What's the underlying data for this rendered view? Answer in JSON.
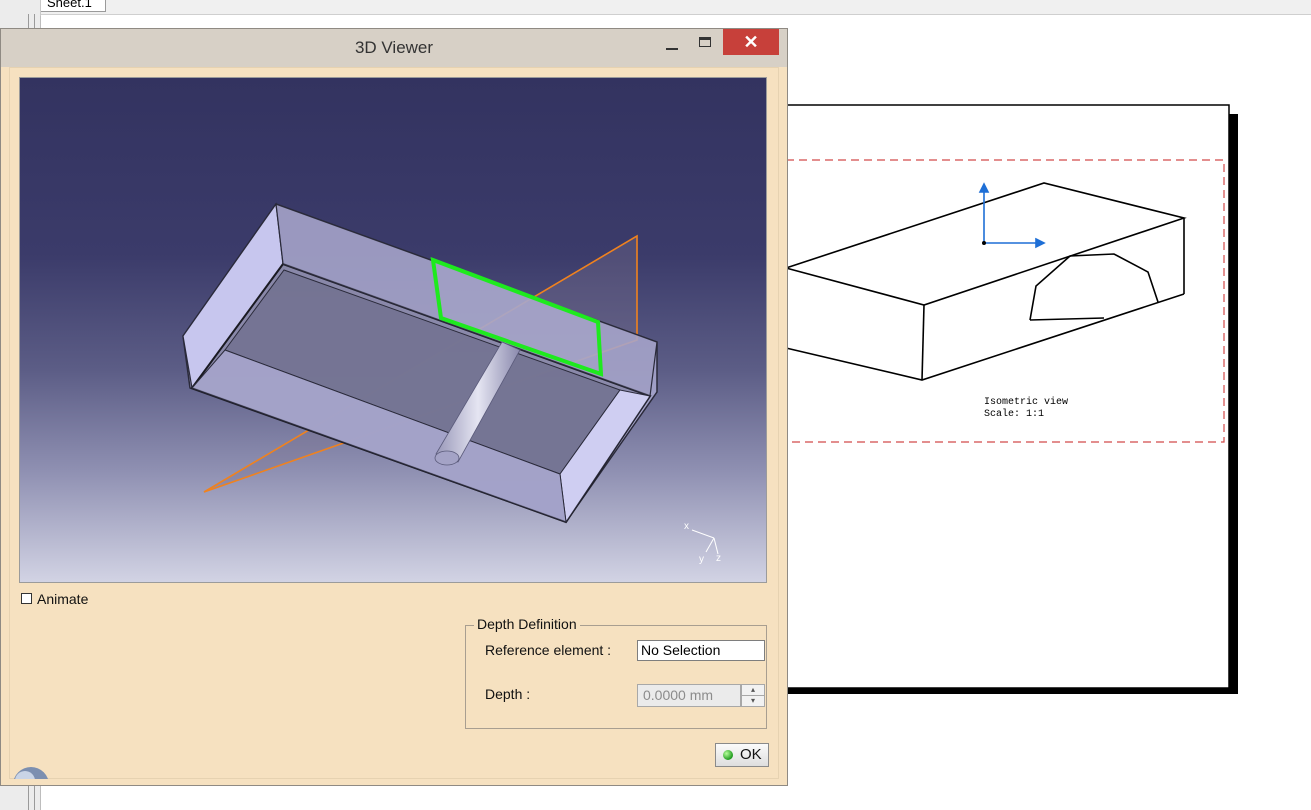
{
  "background": {
    "sheet_tab": "Sheet.1",
    "view_label": "Isometric view",
    "scale_label": "Scale:  1:1"
  },
  "dialog": {
    "title": "3D Viewer",
    "minimize_icon": "minimize-icon",
    "maximize_icon": "maximize-icon",
    "close_icon": "close-icon",
    "close_glyph": "✕",
    "viewport": {
      "triad_labels": [
        "x",
        "y",
        "z"
      ],
      "colors": {
        "cutting_plane": "#f0821e",
        "section_outline": "#1eea1e",
        "part_face": "#c7c6ee"
      }
    },
    "animate": {
      "label": "Animate",
      "checked": false
    },
    "depth_definition": {
      "group_title": "Depth Definition",
      "reference_label": "Reference element :",
      "reference_value": "No Selection",
      "depth_label": "Depth :",
      "depth_value": "0.0000 mm"
    },
    "ok_button": {
      "label": "OK",
      "icon": "green-dot-icon"
    }
  },
  "colors": {
    "dialog_bg": "#f6e1c0",
    "titlebar_bg": "#d7d0c6",
    "close_button": "#c7403a",
    "axis_blue": "#1e6fd6",
    "frame_dashed_red": "#d24a4a"
  }
}
